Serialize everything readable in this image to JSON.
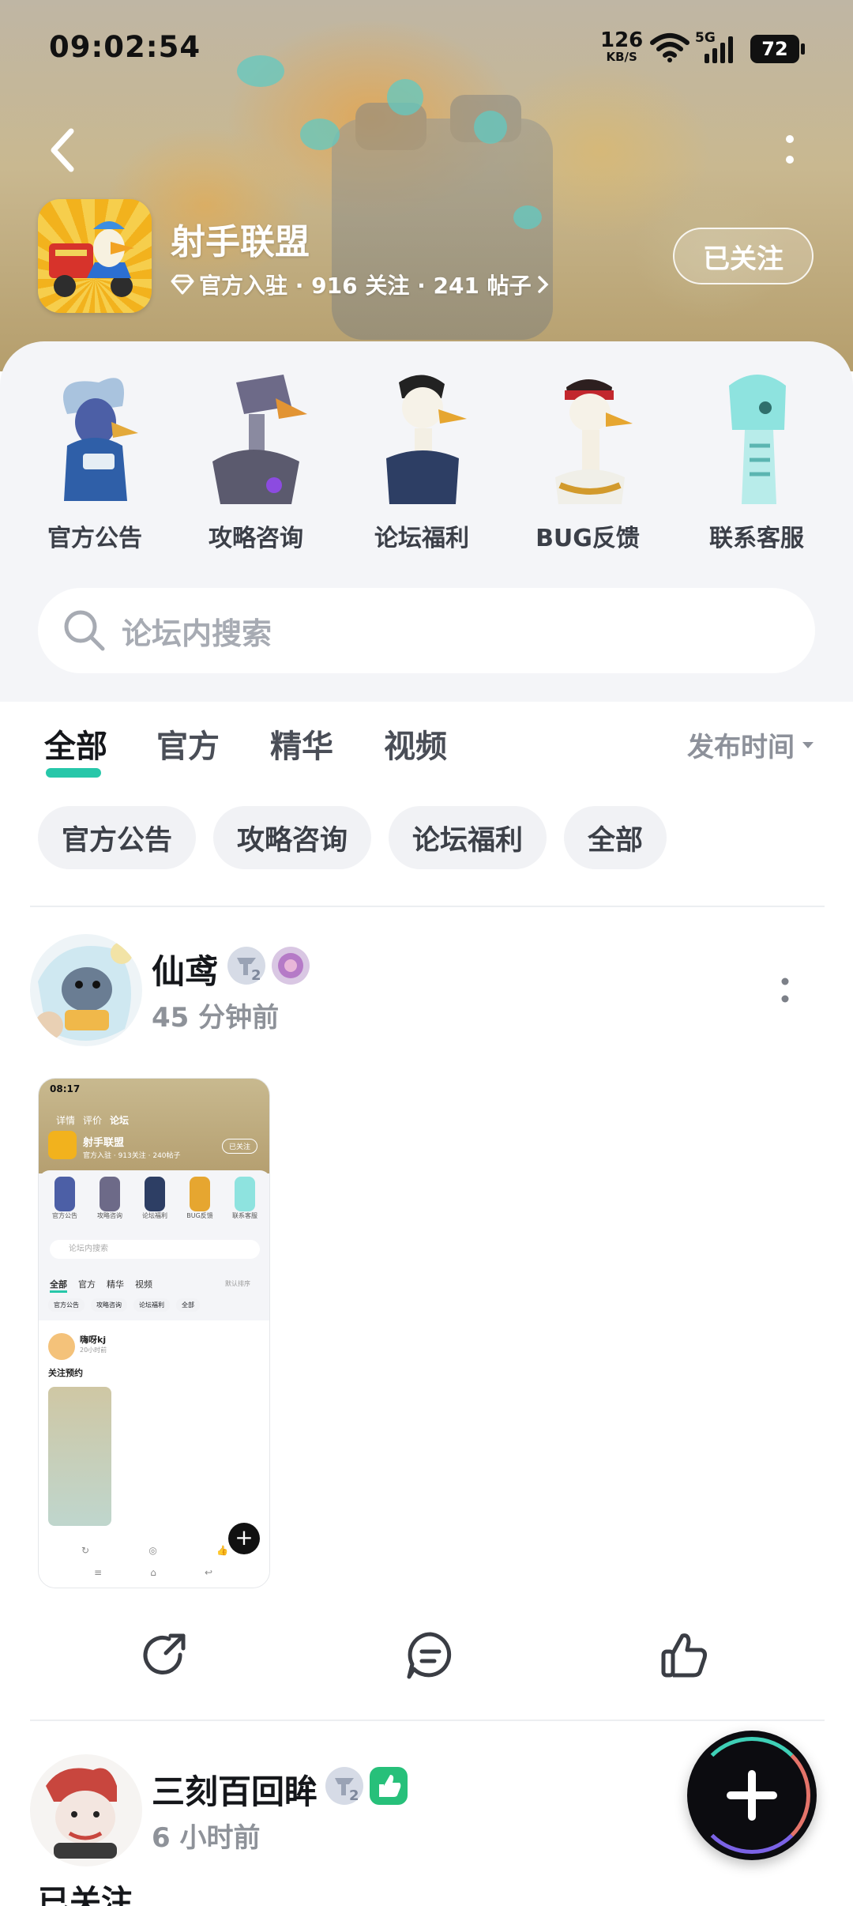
{
  "status_bar": {
    "time": "09:02:54",
    "net_speed_value": "126",
    "net_speed_unit": "KB/S",
    "network": "5G",
    "battery": "72"
  },
  "header": {
    "forum_name": "射手联盟",
    "meta": "官方入驻 · 916 关注 · 241 帖子",
    "follow_label": "已关注"
  },
  "categories": [
    {
      "label": "官方公告"
    },
    {
      "label": "攻略咨询"
    },
    {
      "label": "论坛福利"
    },
    {
      "label": "BUG反馈"
    },
    {
      "label": "联系客服"
    }
  ],
  "search": {
    "placeholder": "论坛内搜索"
  },
  "tabs": [
    {
      "label": "全部",
      "active": true
    },
    {
      "label": "官方"
    },
    {
      "label": "精华"
    },
    {
      "label": "视频"
    }
  ],
  "sort": {
    "label": "发布时间"
  },
  "chips": [
    {
      "label": "官方公告"
    },
    {
      "label": "攻略咨询"
    },
    {
      "label": "论坛福利"
    },
    {
      "label": "全部"
    }
  ],
  "posts": [
    {
      "username": "仙鸢",
      "time": "45 分钟前",
      "level": "2"
    },
    {
      "username": "三刻百回眸",
      "time": "6 小时前",
      "level": "2",
      "title": "已关注"
    }
  ],
  "embedded_screenshot": {
    "time": "08:17",
    "tabs": [
      "详情",
      "评价",
      "论坛"
    ],
    "forum_name": "射手联盟",
    "meta": "官方入驻 · 913关注 · 240帖子",
    "follow_label": "已关注",
    "categories": [
      "官方公告",
      "攻略咨询",
      "论坛福利",
      "BUG反馈",
      "联系客服"
    ],
    "search_placeholder": "论坛内搜索",
    "filter_tabs": [
      "全部",
      "官方",
      "精华",
      "视频"
    ],
    "sort_label": "默认排序",
    "chips": [
      "官方公告",
      "攻略咨询",
      "论坛福利",
      "全部"
    ],
    "post_user": "嗨呀kj",
    "post_time": "20小时前",
    "post_title": "关注预约"
  },
  "colors": {
    "accent": "#27c7a9",
    "text": "#15171b",
    "muted": "#8e9299"
  }
}
